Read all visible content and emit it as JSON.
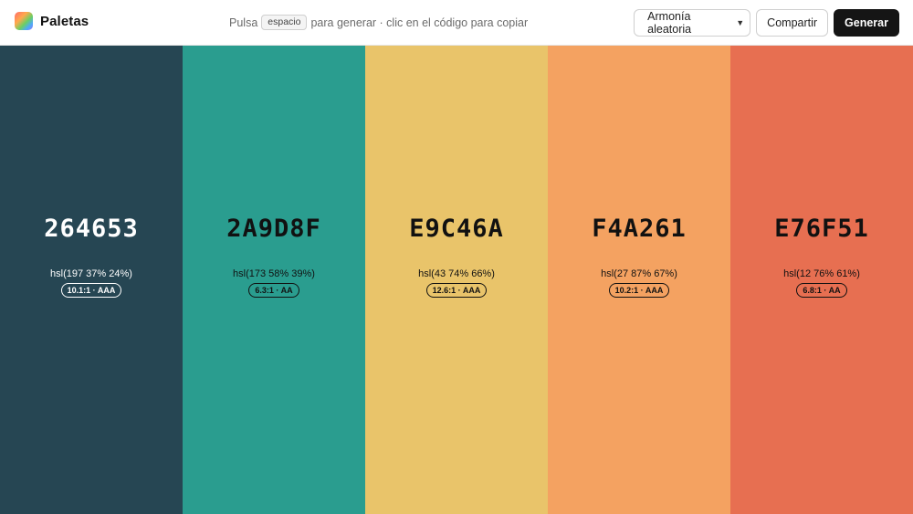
{
  "app": {
    "name": "Paletas"
  },
  "hint": {
    "prefix": "Pulsa",
    "key": "espacio",
    "suffix": "para generar · clic en el código para copiar"
  },
  "controls": {
    "harmony_select": "Armonía aleatoria",
    "share_label": "Compartir",
    "generate_label": "Generar"
  },
  "swatches": [
    {
      "hex": "264653",
      "hsl": "hsl(197 37% 24%)",
      "contrast": "10.1:1 · AAA",
      "bg": "#264653",
      "fg": "#ffffff"
    },
    {
      "hex": "2A9D8F",
      "hsl": "hsl(173 58% 39%)",
      "contrast": "6.3:1 · AA",
      "bg": "#2a9d8f",
      "fg": "#111111"
    },
    {
      "hex": "E9C46A",
      "hsl": "hsl(43 74% 66%)",
      "contrast": "12.6:1 · AAA",
      "bg": "#e9c46a",
      "fg": "#111111"
    },
    {
      "hex": "F4A261",
      "hsl": "hsl(27 87% 67%)",
      "contrast": "10.2:1 · AAA",
      "bg": "#f4a261",
      "fg": "#111111"
    },
    {
      "hex": "E76F51",
      "hsl": "hsl(12 76% 61%)",
      "contrast": "6.8:1 · AA",
      "bg": "#e76f51",
      "fg": "#111111"
    }
  ]
}
